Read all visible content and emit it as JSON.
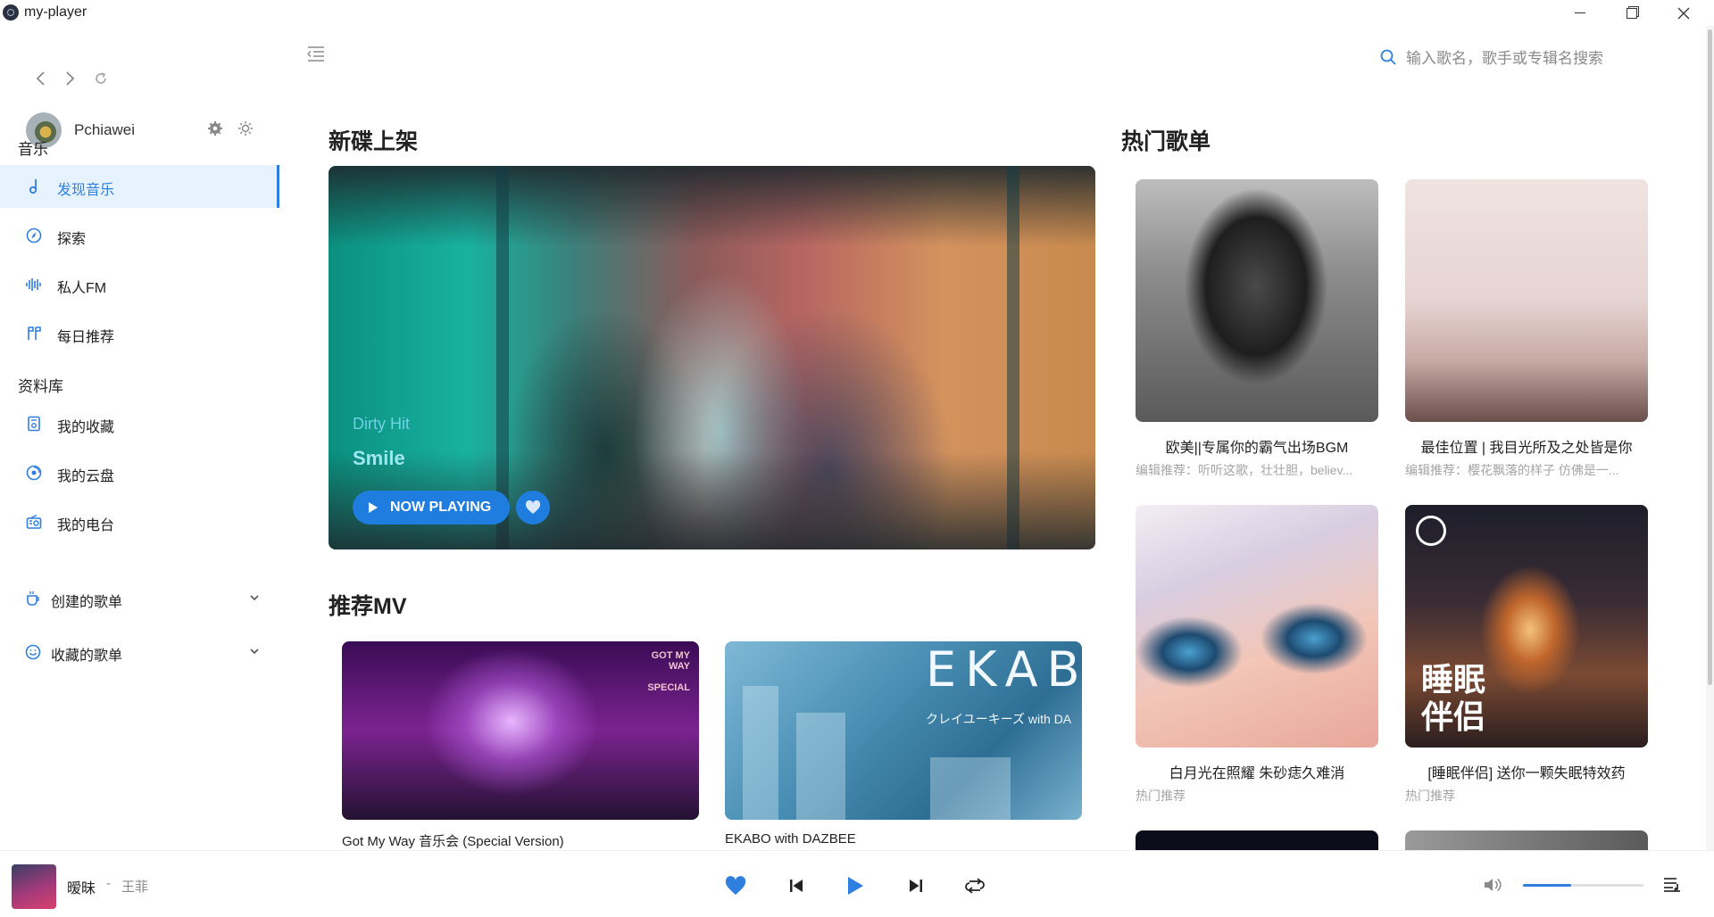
{
  "window": {
    "title": "my-player"
  },
  "sidebar": {
    "username": "Pchiawei",
    "sections": {
      "music": "音乐",
      "library": "资料库"
    },
    "music_items": [
      {
        "label": "发现音乐",
        "icon": "music-note-icon",
        "active": true
      },
      {
        "label": "探索",
        "icon": "compass-icon"
      },
      {
        "label": "私人FM",
        "icon": "fm-wave-icon"
      },
      {
        "label": "每日推荐",
        "icon": "daily-flag-icon"
      }
    ],
    "library_items": [
      {
        "label": "我的收藏",
        "icon": "collection-icon"
      },
      {
        "label": "我的云盘",
        "icon": "cloud-disk-icon"
      },
      {
        "label": "我的电台",
        "icon": "radio-icon"
      }
    ],
    "groups": [
      {
        "label": "创建的歌单",
        "icon": "cup-icon"
      },
      {
        "label": "收藏的歌单",
        "icon": "smile-icon"
      }
    ]
  },
  "search": {
    "placeholder": "输入歌名，歌手或专辑名搜索"
  },
  "sections": {
    "new_albums": "新碟上架",
    "mv": "推荐MV",
    "hot_playlists": "热门歌单"
  },
  "featured": {
    "label": "Dirty Hit",
    "title": "Smile",
    "button": "NOW PLAYING"
  },
  "mvs": [
    {
      "title": "Got My Way 音乐会 (Special Version)",
      "art_text": "GOT MY WAY",
      "art_badge": "SPECIAL"
    },
    {
      "title": "EKABO with DAZBEE",
      "art_text": "EKAB",
      "art_sub": "クレイユーキーズ with DA"
    }
  ],
  "playlists": [
    {
      "title": "欧美||专属你的霸气出场BGM",
      "subtitle": "编辑推荐：听听这歌，壮壮胆，believ..."
    },
    {
      "title": "最佳位置 | 我目光所及之处皆是你",
      "subtitle": "编辑推荐：樱花飘落的样子 仿佛是一..."
    },
    {
      "title": "白月光在照耀 朱砂痣久难消",
      "subtitle": "热门推荐"
    },
    {
      "title": "[睡眠伴侣] 送你一颗失眠特效药",
      "subtitle": "热门推荐",
      "art_text": "睡眠\n伴侣"
    }
  ],
  "player": {
    "song": "暧昧",
    "separator": "-",
    "artist": "王菲",
    "volume": 0.4,
    "accent": "#2e7fe0"
  }
}
